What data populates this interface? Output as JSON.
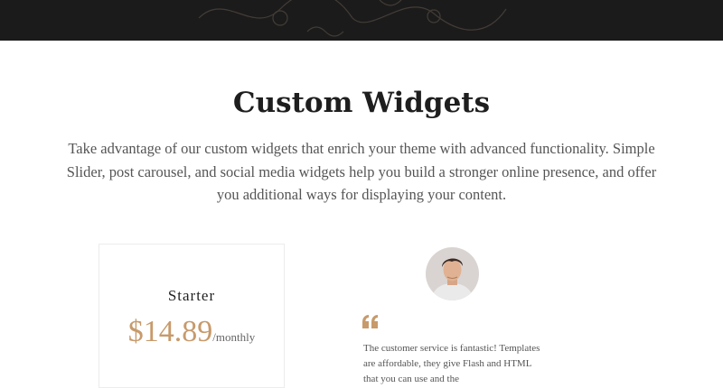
{
  "hero": {
    "background_color": "#1c1b1b",
    "decoration_icon": "swirl-ornament-icon"
  },
  "section": {
    "title": "Custom Widgets",
    "description": "Take advantage of our custom widgets that enrich your theme with advanced functionality. Simple Slider, post carousel, and social media widgets help you build a stronger online presence, and offer you additional ways for displaying your content."
  },
  "pricing": {
    "plan_name": "Starter",
    "price": "$14.89",
    "period": "/monthly",
    "accent_color": "#c79a6b"
  },
  "testimonial": {
    "avatar_icon": "person-avatar",
    "quote_icon": "quote-mark-icon",
    "text": "The customer service is fantastic! Templates are affordable, they give Flash and HTML that you can use and the"
  }
}
